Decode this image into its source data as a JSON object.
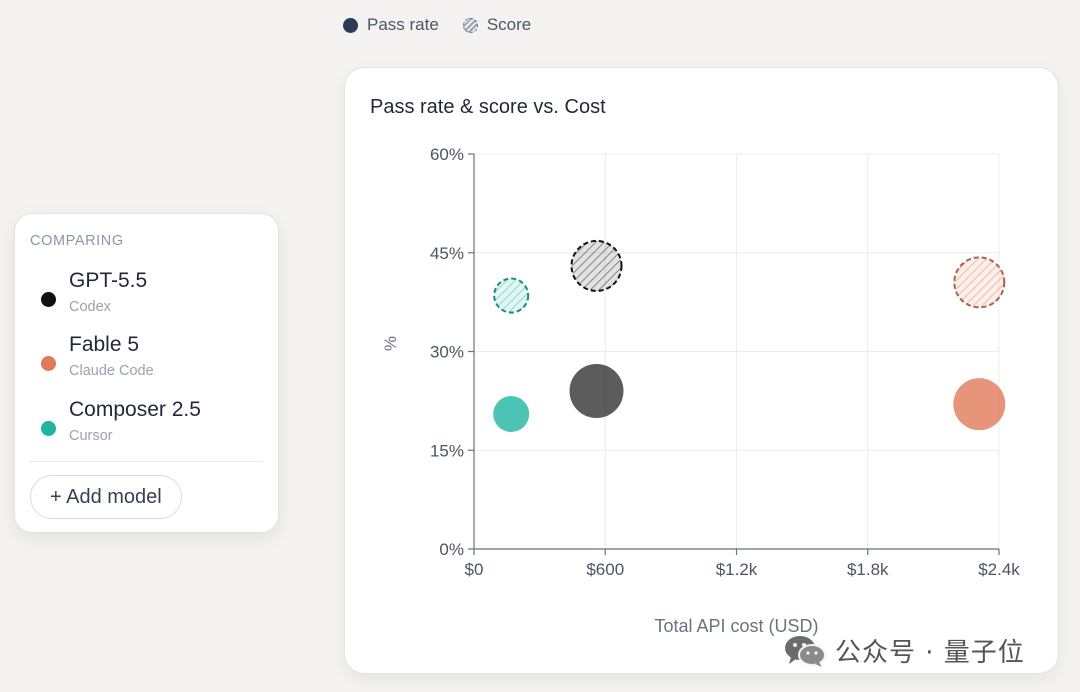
{
  "legend": {
    "pass_rate_label": "Pass rate",
    "score_label": "Score"
  },
  "compare": {
    "heading": "COMPARING",
    "models": [
      {
        "name": "GPT-5.5",
        "tool": "Codex",
        "color": "#111111"
      },
      {
        "name": "Fable 5",
        "tool": "Claude Code",
        "color": "#e07b5a"
      },
      {
        "name": "Composer 2.5",
        "tool": "Cursor",
        "color": "#1fb5a0"
      }
    ],
    "add_button_label": "+ Add model"
  },
  "chart_data": {
    "type": "scatter",
    "title": "Pass rate & score vs. Cost",
    "xlabel": "Total API cost (USD)",
    "ylabel": "%",
    "xlim": [
      0,
      2400
    ],
    "ylim": [
      0,
      60
    ],
    "x_ticks": [
      {
        "value": 0,
        "label": "$0"
      },
      {
        "value": 600,
        "label": "$600"
      },
      {
        "value": 1200,
        "label": "$1.2k"
      },
      {
        "value": 1800,
        "label": "$1.8k"
      },
      {
        "value": 2400,
        "label": "$2.4k"
      }
    ],
    "y_ticks": [
      {
        "value": 0,
        "label": "0%"
      },
      {
        "value": 15,
        "label": "15%"
      },
      {
        "value": 30,
        "label": "30%"
      },
      {
        "value": 45,
        "label": "45%"
      },
      {
        "value": 60,
        "label": "60%"
      }
    ],
    "grid": true,
    "series": [
      {
        "name": "Pass rate",
        "style": "solid",
        "points": [
          {
            "model": "GPT-5.5",
            "x": 560,
            "y": 24
          },
          {
            "model": "Fable 5",
            "x": 2310,
            "y": 22
          },
          {
            "model": "Composer 2.5",
            "x": 170,
            "y": 20.5
          }
        ]
      },
      {
        "name": "Score",
        "style": "hatched",
        "points": [
          {
            "model": "GPT-5.5",
            "x": 560,
            "y": 43
          },
          {
            "model": "Fable 5",
            "x": 2310,
            "y": 40.5
          },
          {
            "model": "Composer 2.5",
            "x": 170,
            "y": 38.5
          }
        ]
      }
    ]
  },
  "watermark": {
    "text": "公众号 · 量子位"
  }
}
